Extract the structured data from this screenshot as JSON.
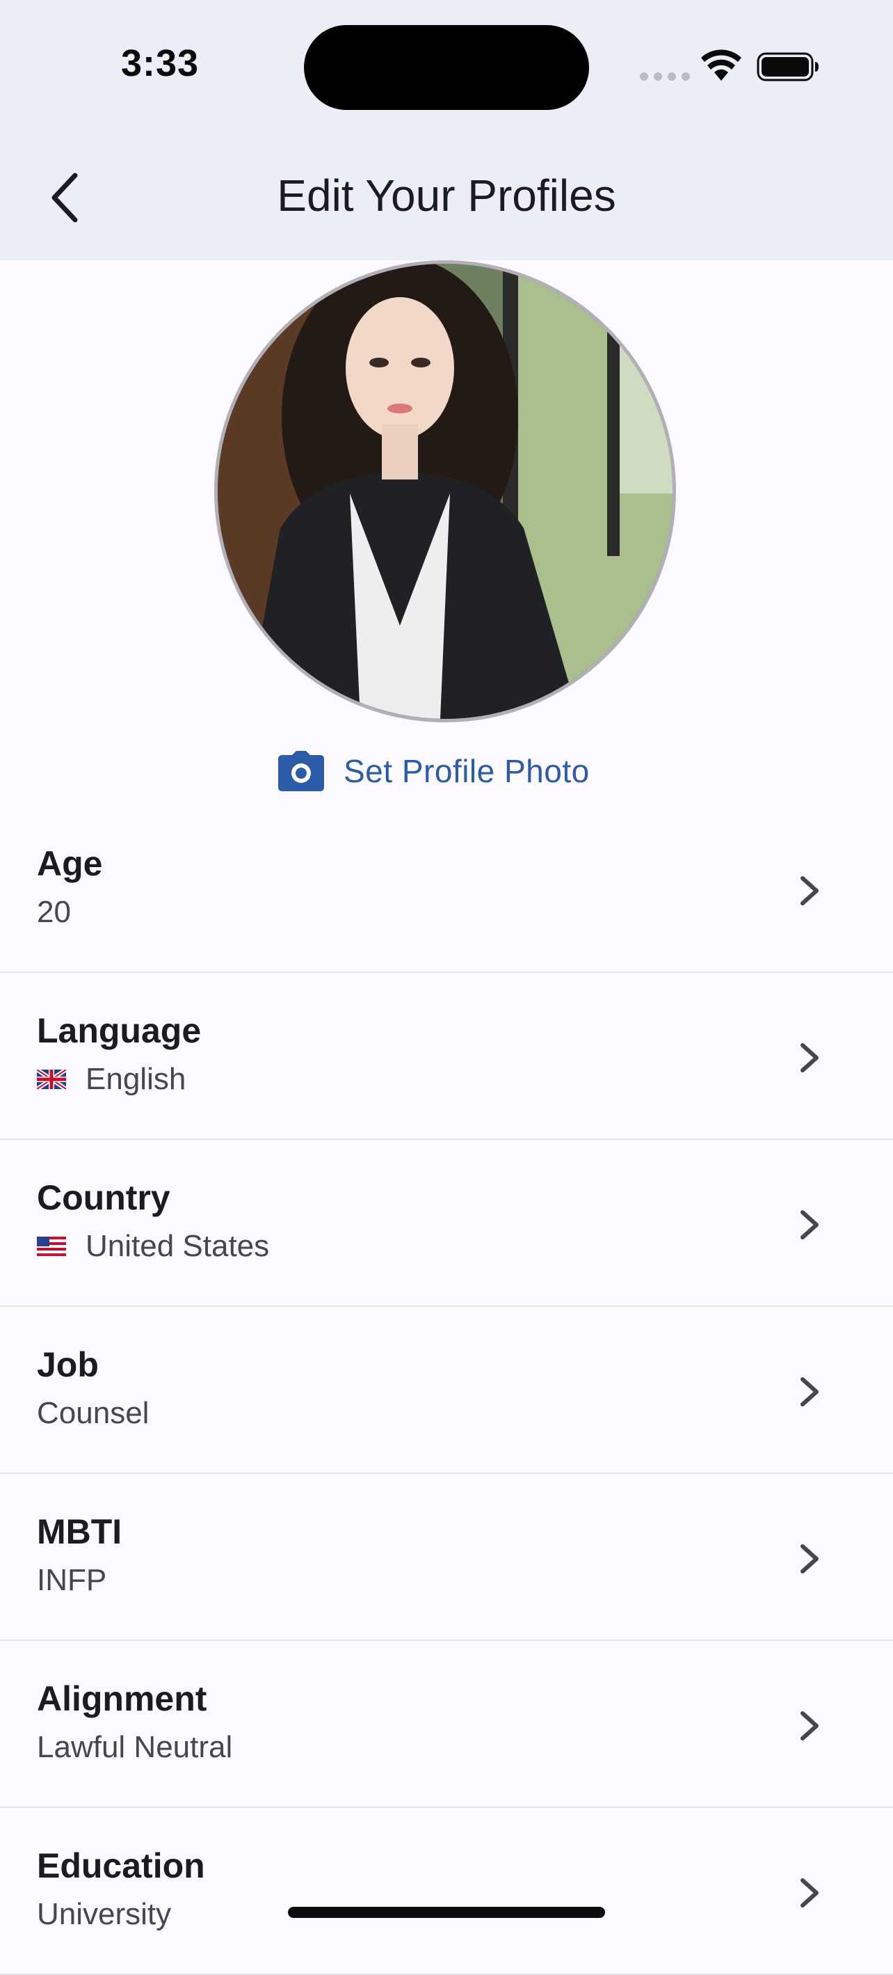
{
  "status_bar": {
    "time": "3:33"
  },
  "header": {
    "title": "Edit Your Profiles",
    "background": "#ebeef7"
  },
  "profile_photo": {
    "action_label": "Set Profile Photo",
    "action_color": "#2c5ca8"
  },
  "rows": [
    {
      "title": "Age",
      "value": "20"
    },
    {
      "title": "Language",
      "value": "English",
      "flag": "uk-flag-icon"
    },
    {
      "title": "Country",
      "value": "United States",
      "flag": "us-flag-icon"
    },
    {
      "title": "Job",
      "value": "Counsel"
    },
    {
      "title": "MBTI",
      "value": "INFP"
    },
    {
      "title": "Alignment",
      "value": "Lawful Neutral"
    },
    {
      "title": "Education",
      "value": "University"
    }
  ]
}
